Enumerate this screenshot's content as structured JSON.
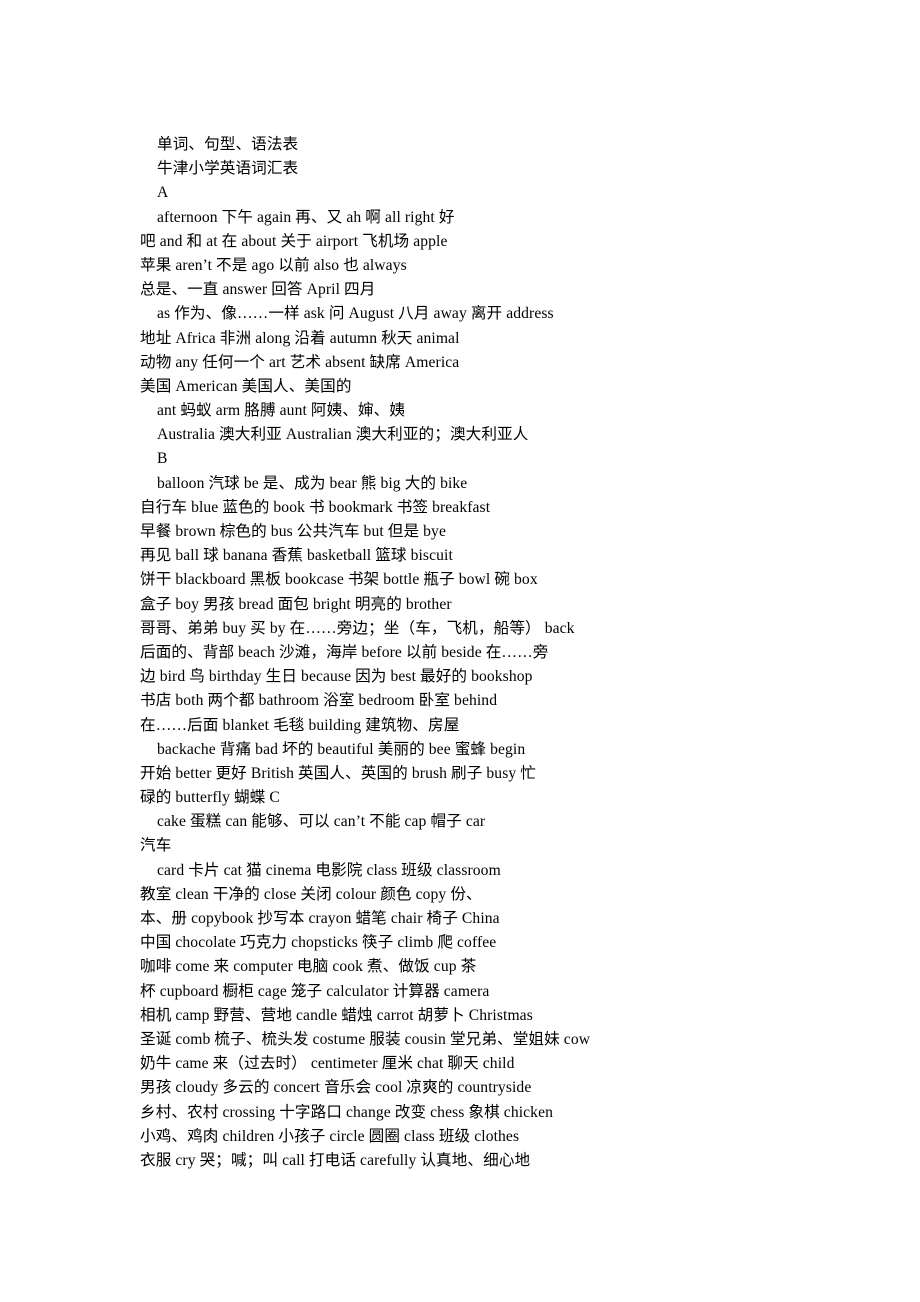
{
  "document": {
    "title_line_1": "单词、句型、语法表",
    "title_line_2": "牛津小学英语词汇表",
    "section_a": "A",
    "section_b": "B",
    "section_c": "C"
  },
  "lines": [
    {
      "id": "l01",
      "indent": true,
      "text": "单词、句型、语法表"
    },
    {
      "id": "l02",
      "indent": true,
      "text": "牛津小学英语词汇表"
    },
    {
      "id": "l03",
      "indent": true,
      "text": "A"
    },
    {
      "id": "l04",
      "indent": true,
      "text": "afternoon 下午                again 再、又              ah 啊            all right 好"
    },
    {
      "id": "l05",
      "indent": false,
      "text": "吧            and 和            at 在 about 关于              airport 飞机场                  apple"
    },
    {
      "id": "l06",
      "indent": false,
      "text": "苹果      aren’t 不是            ago 以前            also 也                            always"
    },
    {
      "id": "l07",
      "indent": false,
      "text": "总是、一直      answer 回答      April 四月"
    },
    {
      "id": "l08",
      "indent": true,
      "text": "as 作为、像……一样   ask 问                  August 八月     away 离开            address"
    },
    {
      "id": "l09",
      "indent": false,
      "text": "地址       Africa 非洲               along 沿着             autumn 秋天      animal"
    },
    {
      "id": "l10",
      "indent": false,
      "text": "动物          any 任何一个 art 艺术                absent 缺席                America"
    },
    {
      "id": "l11",
      "indent": false,
      "text": "美国    American 美国人、美国的"
    },
    {
      "id": "l12",
      "indent": true,
      "text": "ant 蚂蚁              arm 胳膊       aunt 阿姨、婶、姨"
    },
    {
      "id": "l13",
      "indent": true,
      "text": "Australia 澳大利亚      Australian 澳大利亚的；澳大利亚人"
    },
    {
      "id": "l14",
      "indent": true,
      "text": "B"
    },
    {
      "id": "l15",
      "indent": true,
      "text": "balloon 汽球            be 是、成为           bear 熊              big 大的              bike"
    },
    {
      "id": "l16",
      "indent": false,
      "text": "自行车       blue 蓝色的             book 书              bookmark 书签      breakfast"
    },
    {
      "id": "l17",
      "indent": false,
      "text": "早餐      brown 棕色的   bus 公共汽车        but 但是                 bye"
    },
    {
      "id": "l18",
      "indent": false,
      "text": "再见           ball 球              banana 香蕉 basketball 篮球          biscuit"
    },
    {
      "id": "l19",
      "indent": false,
      "text": "饼干         blackboard 黑板     bookcase 书架         bottle 瓶子 bowl 碗                 box"
    },
    {
      "id": "l20",
      "indent": false,
      "text": "盒子              boy 男孩         bread 面包        bright 明亮的 brother"
    },
    {
      "id": "l21",
      "indent": false,
      "text": "哥哥、弟弟     buy 买      by 在……旁边；坐（车，飞机，船等）        back"
    },
    {
      "id": "l22",
      "indent": false,
      "text": "后面的、背部  beach 沙滩，海岸     before 以前              beside 在……旁"
    },
    {
      "id": "l23",
      "indent": false,
      "text": "边   bird 鸟              birthday 生日 because 因为          best 最好的              bookshop"
    },
    {
      "id": "l24",
      "indent": false,
      "text": "书店       both 两个都      bathroom 浴室 bedroom 卧室            behind"
    },
    {
      "id": "l25",
      "indent": false,
      "text": "在……后面     blanket 毛毯      building 建筑物、房屋"
    },
    {
      "id": "l26",
      "indent": true,
      "text": "backache 背痛        bad 坏的               beautiful 美丽的     bee 蜜蜂              begin"
    },
    {
      "id": "l27",
      "indent": false,
      "text": "开始 better 更好         British 英国人、英国的 brush 刷子          busy 忙"
    },
    {
      "id": "l28",
      "indent": false,
      "text": "碌的        butterfly 蝴蝶 C"
    },
    {
      "id": "l29",
      "indent": true,
      "text": "cake 蛋糕             can 能够、可以       can’t 不能           cap 帽子              car"
    },
    {
      "id": "l30",
      "indent": false,
      "text": "汽车"
    },
    {
      "id": "l31",
      "indent": true,
      "text": "card 卡片          cat 猫              cinema 电影院     class 班级            classroom"
    },
    {
      "id": "l32",
      "indent": false,
      "text": "教室   clean 干净的         close 关闭           colour 颜色        copy 份、"
    },
    {
      "id": "l33",
      "indent": false,
      "text": "本、册      copybook 抄写本 crayon 蜡笔         chair 椅子            China"
    },
    {
      "id": "l34",
      "indent": false,
      "text": "中国        chocolate 巧克力     chopsticks 筷子 climb 爬              coffee"
    },
    {
      "id": "l35",
      "indent": false,
      "text": "咖啡         come 来           computer 电脑      cook 煮、做饭 cup 茶"
    },
    {
      "id": "l36",
      "indent": false,
      "text": "杯           cupboard 橱柜          cage 笼子          calculator 计算器   camera"
    },
    {
      "id": "l37",
      "indent": false,
      "text": "相机 camp 野营、营地      candle 蜡烛          carrot 胡萝卜    Christmas"
    },
    {
      "id": "l38",
      "indent": false,
      "text": "圣诞     comb 梳子、梳头发 costume 服装         cousin 堂兄弟、堂姐妹 cow"
    },
    {
      "id": "l39",
      "indent": false,
      "text": "奶牛         came 来（过去时）   centimeter 厘米   chat 聊天              child"
    },
    {
      "id": "l40",
      "indent": false,
      "text": "男孩             cloudy 多云的      concert 音乐会     cool 凉爽的   countryside"
    },
    {
      "id": "l41",
      "indent": false,
      "text": "乡村、农村 crossing 十字路口     change 改变      chess 象棋     chicken"
    },
    {
      "id": "l42",
      "indent": false,
      "text": "小鸡、鸡肉 children 小孩子      circle 圆圈            class 班级          clothes"
    },
    {
      "id": "l43",
      "indent": false,
      "text": "衣服       cry 哭；喊；叫 call 打电话        carefully 认真地、细心地"
    }
  ],
  "entries": {
    "A": [
      {
        "word": "afternoon",
        "gloss": "下午"
      },
      {
        "word": "again",
        "gloss": "再、又"
      },
      {
        "word": "ah",
        "gloss": "啊"
      },
      {
        "word": "all right",
        "gloss": "好吧"
      },
      {
        "word": "and",
        "gloss": "和"
      },
      {
        "word": "at",
        "gloss": "在"
      },
      {
        "word": "about",
        "gloss": "关于"
      },
      {
        "word": "airport",
        "gloss": "飞机场"
      },
      {
        "word": "apple",
        "gloss": "苹果"
      },
      {
        "word": "aren’t",
        "gloss": "不是"
      },
      {
        "word": "ago",
        "gloss": "以前"
      },
      {
        "word": "also",
        "gloss": "也"
      },
      {
        "word": "always",
        "gloss": "总是、一直"
      },
      {
        "word": "answer",
        "gloss": "回答"
      },
      {
        "word": "April",
        "gloss": "四月"
      },
      {
        "word": "as",
        "gloss": "作为、像……一样"
      },
      {
        "word": "ask",
        "gloss": "问"
      },
      {
        "word": "August",
        "gloss": "八月"
      },
      {
        "word": "away",
        "gloss": "离开"
      },
      {
        "word": "address",
        "gloss": "地址"
      },
      {
        "word": "Africa",
        "gloss": "非洲"
      },
      {
        "word": "along",
        "gloss": "沿着"
      },
      {
        "word": "autumn",
        "gloss": "秋天"
      },
      {
        "word": "animal",
        "gloss": "动物"
      },
      {
        "word": "any",
        "gloss": "任何一个"
      },
      {
        "word": "art",
        "gloss": "艺术"
      },
      {
        "word": "absent",
        "gloss": "缺席"
      },
      {
        "word": "America",
        "gloss": "美国"
      },
      {
        "word": "American",
        "gloss": "美国人、美国的"
      },
      {
        "word": "ant",
        "gloss": "蚂蚁"
      },
      {
        "word": "arm",
        "gloss": "胳膊"
      },
      {
        "word": "aunt",
        "gloss": "阿姨、婶、姨"
      },
      {
        "word": "Australia",
        "gloss": "澳大利亚"
      },
      {
        "word": "Australian",
        "gloss": "澳大利亚的；澳大利亚人"
      }
    ],
    "B": [
      {
        "word": "balloon",
        "gloss": "汽球"
      },
      {
        "word": "be",
        "gloss": "是、成为"
      },
      {
        "word": "bear",
        "gloss": "熊"
      },
      {
        "word": "big",
        "gloss": "大的"
      },
      {
        "word": "bike",
        "gloss": "自行车"
      },
      {
        "word": "blue",
        "gloss": "蓝色的"
      },
      {
        "word": "book",
        "gloss": "书"
      },
      {
        "word": "bookmark",
        "gloss": "书签"
      },
      {
        "word": "breakfast",
        "gloss": "早餐"
      },
      {
        "word": "brown",
        "gloss": "棕色的"
      },
      {
        "word": "bus",
        "gloss": "公共汽车"
      },
      {
        "word": "but",
        "gloss": "但是"
      },
      {
        "word": "bye",
        "gloss": "再见"
      },
      {
        "word": "ball",
        "gloss": "球"
      },
      {
        "word": "banana",
        "gloss": "香蕉"
      },
      {
        "word": "basketball",
        "gloss": "篮球"
      },
      {
        "word": "biscuit",
        "gloss": "饼干"
      },
      {
        "word": "blackboard",
        "gloss": "黑板"
      },
      {
        "word": "bookcase",
        "gloss": "书架"
      },
      {
        "word": "bottle",
        "gloss": "瓶子"
      },
      {
        "word": "bowl",
        "gloss": "碗"
      },
      {
        "word": "box",
        "gloss": "盒子"
      },
      {
        "word": "boy",
        "gloss": "男孩"
      },
      {
        "word": "bread",
        "gloss": "面包"
      },
      {
        "word": "bright",
        "gloss": "明亮的"
      },
      {
        "word": "brother",
        "gloss": "哥哥、弟弟"
      },
      {
        "word": "buy",
        "gloss": "买"
      },
      {
        "word": "by",
        "gloss": "在……旁边；坐（车，飞机，船等）"
      },
      {
        "word": "back",
        "gloss": "后面的、背部"
      },
      {
        "word": "beach",
        "gloss": "沙滩，海岸"
      },
      {
        "word": "before",
        "gloss": "以前"
      },
      {
        "word": "beside",
        "gloss": "在……旁边"
      },
      {
        "word": "bird",
        "gloss": "鸟"
      },
      {
        "word": "birthday",
        "gloss": "生日"
      },
      {
        "word": "because",
        "gloss": "因为"
      },
      {
        "word": "best",
        "gloss": "最好的"
      },
      {
        "word": "bookshop",
        "gloss": "书店"
      },
      {
        "word": "both",
        "gloss": "两个都"
      },
      {
        "word": "bathroom",
        "gloss": "浴室"
      },
      {
        "word": "bedroom",
        "gloss": "卧室"
      },
      {
        "word": "behind",
        "gloss": "在……后面"
      },
      {
        "word": "blanket",
        "gloss": "毛毯"
      },
      {
        "word": "building",
        "gloss": "建筑物、房屋"
      },
      {
        "word": "backache",
        "gloss": "背痛"
      },
      {
        "word": "bad",
        "gloss": "坏的"
      },
      {
        "word": "beautiful",
        "gloss": "美丽的"
      },
      {
        "word": "bee",
        "gloss": "蜜蜂"
      },
      {
        "word": "begin",
        "gloss": "开始"
      },
      {
        "word": "better",
        "gloss": "更好"
      },
      {
        "word": "British",
        "gloss": "英国人、英国的"
      },
      {
        "word": "brush",
        "gloss": "刷子"
      },
      {
        "word": "busy",
        "gloss": "忙碌的"
      },
      {
        "word": "butterfly",
        "gloss": "蝴蝶"
      }
    ],
    "C": [
      {
        "word": "cake",
        "gloss": "蛋糕"
      },
      {
        "word": "can",
        "gloss": "能够、可以"
      },
      {
        "word": "can’t",
        "gloss": "不能"
      },
      {
        "word": "cap",
        "gloss": "帽子"
      },
      {
        "word": "car",
        "gloss": "汽车"
      },
      {
        "word": "card",
        "gloss": "卡片"
      },
      {
        "word": "cat",
        "gloss": "猫"
      },
      {
        "word": "cinema",
        "gloss": "电影院"
      },
      {
        "word": "class",
        "gloss": "班级"
      },
      {
        "word": "classroom",
        "gloss": "教室"
      },
      {
        "word": "clean",
        "gloss": "干净的"
      },
      {
        "word": "close",
        "gloss": "关闭"
      },
      {
        "word": "colour",
        "gloss": "颜色"
      },
      {
        "word": "copy",
        "gloss": "份、本、册"
      },
      {
        "word": "copybook",
        "gloss": "抄写本"
      },
      {
        "word": "crayon",
        "gloss": "蜡笔"
      },
      {
        "word": "chair",
        "gloss": "椅子"
      },
      {
        "word": "China",
        "gloss": "中国"
      },
      {
        "word": "chocolate",
        "gloss": "巧克力"
      },
      {
        "word": "chopsticks",
        "gloss": "筷子"
      },
      {
        "word": "climb",
        "gloss": "爬"
      },
      {
        "word": "coffee",
        "gloss": "咖啡"
      },
      {
        "word": "come",
        "gloss": "来"
      },
      {
        "word": "computer",
        "gloss": "电脑"
      },
      {
        "word": "cook",
        "gloss": "煮、做饭"
      },
      {
        "word": "cup",
        "gloss": "茶杯"
      },
      {
        "word": "cupboard",
        "gloss": "橱柜"
      },
      {
        "word": "cage",
        "gloss": "笼子"
      },
      {
        "word": "calculator",
        "gloss": "计算器"
      },
      {
        "word": "camera",
        "gloss": "相机"
      },
      {
        "word": "camp",
        "gloss": "野营、营地"
      },
      {
        "word": "candle",
        "gloss": "蜡烛"
      },
      {
        "word": "carrot",
        "gloss": "胡萝卜"
      },
      {
        "word": "Christmas",
        "gloss": "圣诞"
      },
      {
        "word": "comb",
        "gloss": "梳子、梳头发"
      },
      {
        "word": "costume",
        "gloss": "服装"
      },
      {
        "word": "cousin",
        "gloss": "堂兄弟、堂姐妹"
      },
      {
        "word": "cow",
        "gloss": "奶牛"
      },
      {
        "word": "came",
        "gloss": "来（过去时）"
      },
      {
        "word": "centimeter",
        "gloss": "厘米"
      },
      {
        "word": "chat",
        "gloss": "聊天"
      },
      {
        "word": "child",
        "gloss": "男孩"
      },
      {
        "word": "cloudy",
        "gloss": "多云的"
      },
      {
        "word": "concert",
        "gloss": "音乐会"
      },
      {
        "word": "cool",
        "gloss": "凉爽的"
      },
      {
        "word": "countryside",
        "gloss": "乡村、农村"
      },
      {
        "word": "crossing",
        "gloss": "十字路口"
      },
      {
        "word": "change",
        "gloss": "改变"
      },
      {
        "word": "chess",
        "gloss": "象棋"
      },
      {
        "word": "chicken",
        "gloss": "小鸡、鸡肉"
      },
      {
        "word": "children",
        "gloss": "小孩子"
      },
      {
        "word": "circle",
        "gloss": "圆圈"
      },
      {
        "word": "clothes",
        "gloss": "衣服"
      },
      {
        "word": "cry",
        "gloss": "哭；喊；叫"
      },
      {
        "word": "call",
        "gloss": "打电话"
      },
      {
        "word": "carefully",
        "gloss": "认真地、细心地"
      }
    ]
  }
}
